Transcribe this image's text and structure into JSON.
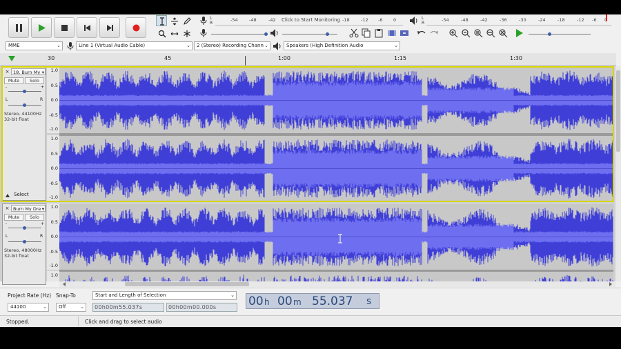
{
  "toolbar": {
    "transport": {
      "pause_label": "Pause",
      "play_label": "Play",
      "stop_label": "Stop",
      "skip_start_label": "Skip to Start",
      "skip_end_label": "Skip to End",
      "record_label": "Record",
      "record_color": "#e02020",
      "play_color": "#2aa22a"
    },
    "monitor_text": "Click to Start Monitoring",
    "record_meter_scale": [
      "-54",
      "-48",
      "-42",
      "-18",
      "-12",
      "-6",
      "0"
    ],
    "play_meter_scale": [
      "-54",
      "-48",
      "-42",
      "-36",
      "-30",
      "-24",
      "-18",
      "-12",
      "-6",
      "0"
    ]
  },
  "device_bar": {
    "host": "MME",
    "recording_device": "Line 1 (Virtual Audio Cable)",
    "recording_channels": "2 (Stereo) Recording Chann",
    "playback_device": "Speakers (High Definition Audio"
  },
  "timeline": {
    "labels": [
      "30",
      "45",
      "1:00",
      "1:15",
      "1:30"
    ]
  },
  "tracks": [
    {
      "name": "18. Burn My",
      "mute_label": "Mute",
      "solo_label": "Solo",
      "gain_left": "-",
      "gain_right": "+",
      "pan_left": "L",
      "pan_right": "R",
      "format_line1": "Stereo, 44100Hz",
      "format_line2": "32-bit float",
      "select_label": "Select",
      "scale_top": [
        "1.0",
        "0.5",
        "0.0",
        "-0.5",
        "-1.0"
      ],
      "scale_bottom": [
        "1.0",
        "0.5",
        "0.0",
        "-0.5",
        "-1.0"
      ]
    },
    {
      "name": "Burn My Dre",
      "mute_label": "Mute",
      "solo_label": "Solo",
      "gain_left": "-",
      "gain_right": "+",
      "pan_left": "L",
      "pan_right": "R",
      "format_line1": "Stereo, 48000Hz",
      "format_line2": "32-bit float",
      "scale_top": [
        "1.0",
        "0.5",
        "0.0",
        "-0.5",
        "-1.0"
      ],
      "scale_bottom_first": "1.0"
    }
  ],
  "colors": {
    "waveform": "#3f3fd8",
    "waveform_rms": "#6e6ef0",
    "selection_border": "#d6d600",
    "track_bg": "#c8c8c8"
  },
  "selection_bar": {
    "project_rate_label": "Project Rate (Hz)",
    "project_rate_value": "44100",
    "snap_to_label": "Snap-To",
    "snap_to_value": "Off",
    "selection_mode": "Start and Length of Selection",
    "start_time": "00h00m55.037s",
    "length_time": "00h00m00.000s",
    "audio_position": "00h00m55.037s",
    "audio_position_parts": [
      "00",
      "h",
      "00",
      "m",
      "55.037",
      "s"
    ]
  },
  "status": {
    "state": "Stopped.",
    "hint": "Click and drag to select audio"
  }
}
